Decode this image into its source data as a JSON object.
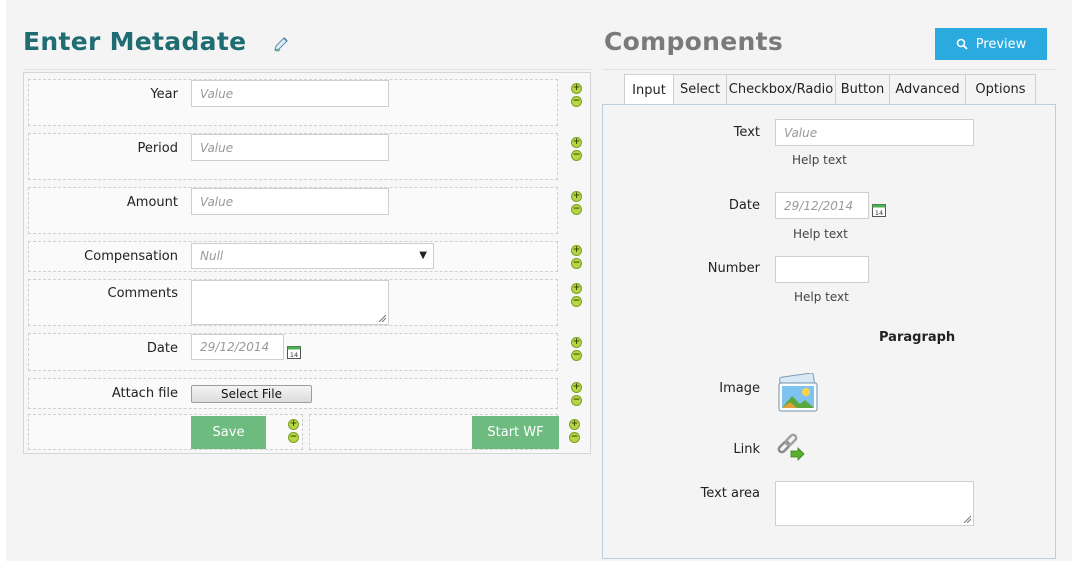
{
  "left": {
    "title": "Enter Metadate",
    "fields": {
      "year": {
        "label": "Year",
        "placeholder": "Value"
      },
      "period": {
        "label": "Period",
        "placeholder": "Value"
      },
      "amount": {
        "label": "Amount",
        "placeholder": "Value"
      },
      "compensation": {
        "label": "Compensation",
        "value": "Null"
      },
      "comments": {
        "label": "Comments"
      },
      "date": {
        "label": "Date",
        "placeholder": "29/12/2014",
        "calendar_day": "14"
      },
      "attach": {
        "label": "Attach file",
        "button": "Select File"
      }
    },
    "save_label": "Save",
    "start_label": "Start WF",
    "plus": "+",
    "minus": "−"
  },
  "right": {
    "title": "Components",
    "preview_label": "Preview",
    "tabs": [
      {
        "label": "Input"
      },
      {
        "label": "Select"
      },
      {
        "label": "Checkbox/Radio"
      },
      {
        "label": "Button"
      },
      {
        "label": "Advanced"
      },
      {
        "label": "Options"
      }
    ],
    "text": {
      "label": "Text",
      "placeholder": "Value",
      "help": "Help text"
    },
    "date": {
      "label": "Date",
      "placeholder": "29/12/2014",
      "help": "Help text",
      "calendar_day": "14"
    },
    "number": {
      "label": "Number",
      "help": "Help text"
    },
    "paragraph": "Paragraph",
    "image_label": "Image",
    "link_label": "Link",
    "textarea_label": "Text area"
  },
  "colors": {
    "title_teal": "#1f6d72",
    "preview_blue": "#2baadf",
    "button_green": "#6dbb7f",
    "ctrl_green": "#b6d646"
  }
}
